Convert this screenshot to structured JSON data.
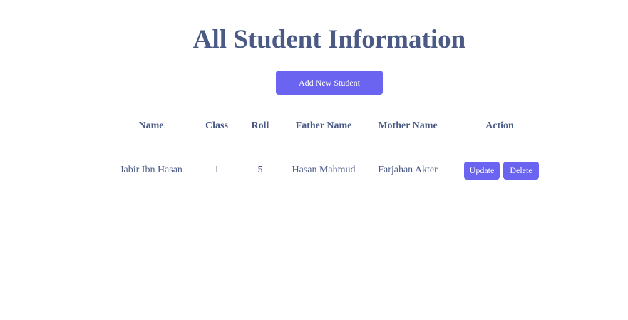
{
  "page": {
    "title": "All Student Information"
  },
  "toolbar": {
    "add_label": "Add New Student"
  },
  "table": {
    "headers": [
      "Name",
      "Class",
      "Roll",
      "Father Name",
      "Mother Name",
      "Action"
    ],
    "rows": [
      {
        "name": "Jabir Ibn Hasan",
        "class": "1",
        "roll": "5",
        "father_name": "Hasan Mahmud",
        "mother_name": "Farjahan Akter",
        "actions": {
          "update_label": "Update",
          "delete_label": "Delete"
        }
      }
    ]
  },
  "colors": {
    "accent": "#6a64f1",
    "text": "#4a5a85",
    "background": "#ffffff"
  }
}
